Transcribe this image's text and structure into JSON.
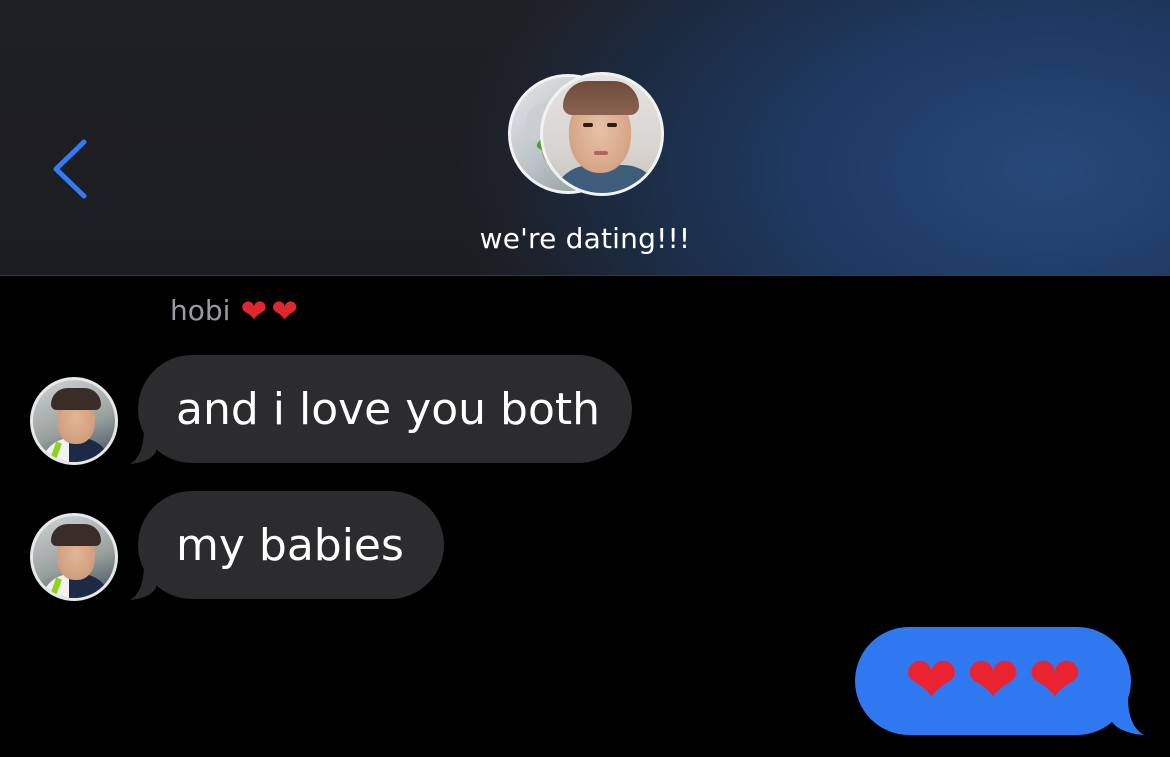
{
  "header": {
    "group_name": "we're dating!!!"
  },
  "thread": {
    "sender_name": "hobi",
    "sender_name_emoji": [
      "❤",
      "❤"
    ],
    "incoming": [
      {
        "text": "and i love you both"
      },
      {
        "text": "my babies"
      }
    ],
    "outgoing": {
      "emoji": [
        "❤",
        "❤",
        "❤"
      ]
    }
  },
  "colors": {
    "incoming_bubble": "#2c2c2e",
    "outgoing_bubble": "#2f78f0",
    "accent": "#2f7cf6",
    "heart": "#e0262f"
  }
}
